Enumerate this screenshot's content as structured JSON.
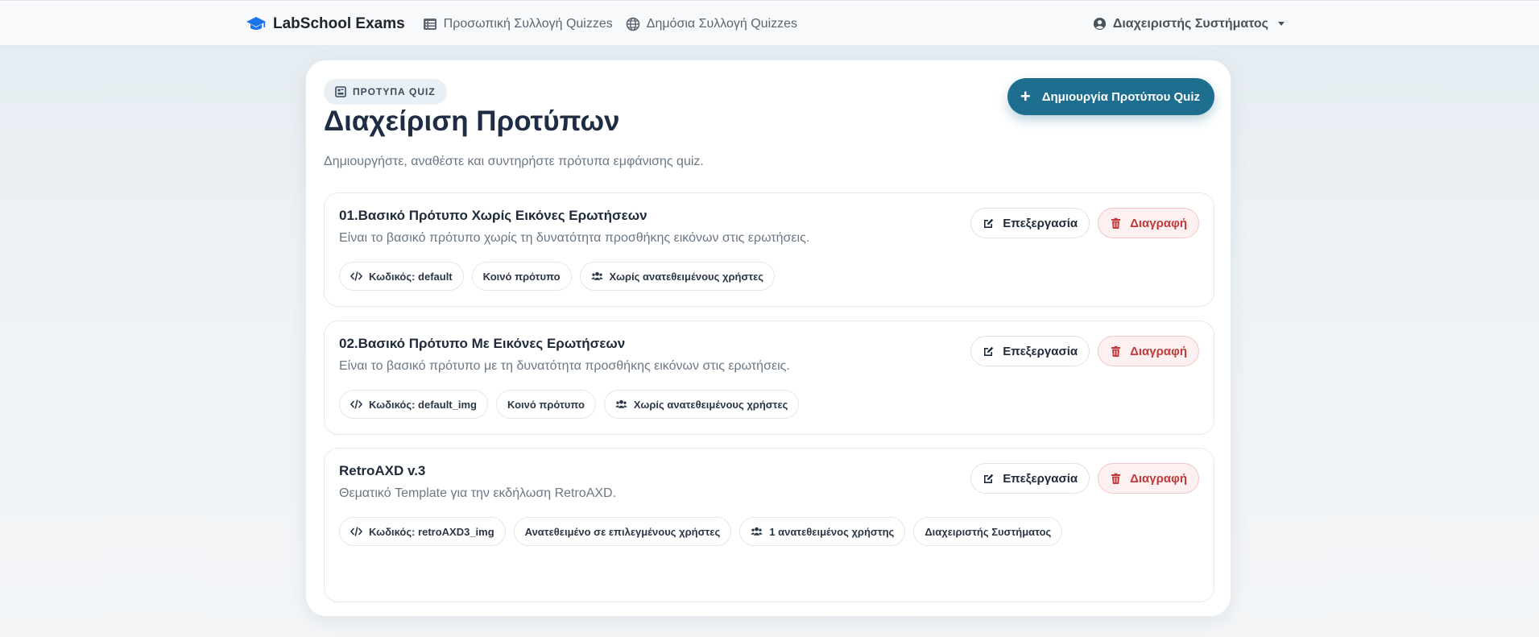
{
  "navbar": {
    "brand": "LabSchool Exams",
    "links": [
      {
        "label": "Προσωπική Συλλογή Quizzes",
        "icon": "collection-icon"
      },
      {
        "label": "Δημόσια Συλλογή Quizzes",
        "icon": "globe-icon"
      }
    ],
    "user": "Διαχειριστής Συστήματος"
  },
  "header": {
    "badge": "ΠΡΟΤΥΠΑ QUIZ",
    "title": "Διαχείριση Προτύπων",
    "subtitle": "Δημιουργήστε, αναθέστε και συντηρήστε πρότυπα εμφάνισης quiz.",
    "create_button": "Δημιουργία Προτύπου Quiz"
  },
  "actions": {
    "edit": "Επεξεργασία",
    "delete": "Διαγραφή"
  },
  "templates": [
    {
      "title": "01.Βασικό Πρότυπο Χωρίς Εικόνες Ερωτήσεων",
      "description": "Είναι το βασικό πρότυπο χωρίς τη δυνατότητα προσθήκης εικόνων στις ερωτήσεις.",
      "code": "Κωδικός: default",
      "visibility": "Κοινό πρότυπο",
      "users": "Χωρίς ανατεθειμένους χρήστες",
      "owner": ""
    },
    {
      "title": "02.Βασικό Πρότυπο Με Εικόνες Ερωτήσεων",
      "description": "Είναι το βασικό πρότυπο με τη δυνατότητα προσθήκης εικόνων στις ερωτήσεις.",
      "code": "Κωδικός: default_img",
      "visibility": "Κοινό πρότυπο",
      "users": "Χωρίς ανατεθειμένους χρήστες",
      "owner": ""
    },
    {
      "title": "RetroAXD v.3",
      "description": "Θεματικό Template για την εκδήλωση RetroAXD.",
      "code": "Κωδικός: retroAXD3_img",
      "visibility": "Ανατεθειμένο σε επιλεγμένους χρήστες",
      "users": "1 ανατεθειμένος χρήστης",
      "owner": "Διαχειριστής Συστήματος"
    }
  ],
  "colors": {
    "primary": "#1d6e8f",
    "danger": "#c0393b",
    "brand_icon": "#1a73e8"
  }
}
